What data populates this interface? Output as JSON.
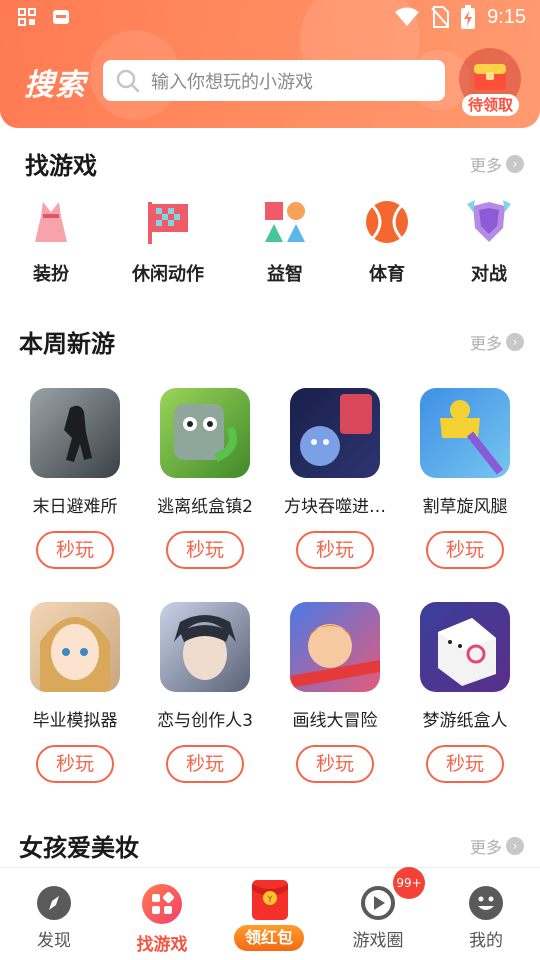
{
  "status_bar": {
    "time": "9:15"
  },
  "header": {
    "title": "搜索",
    "search_placeholder": "输入你想玩的小游戏",
    "gift_badge": "待领取"
  },
  "find_games": {
    "title": "找游戏",
    "more": "更多",
    "categories": [
      {
        "label": "装扮",
        "icon": "dress-icon"
      },
      {
        "label": "休闲动作",
        "icon": "checkered-flag-icon"
      },
      {
        "label": "益智",
        "icon": "shapes-icon"
      },
      {
        "label": "体育",
        "icon": "tennis-ball-icon"
      },
      {
        "label": "对战",
        "icon": "versus-shield-icon"
      }
    ]
  },
  "new_this_week": {
    "title": "本周新游",
    "more": "更多",
    "play_label": "秒玩",
    "games": [
      {
        "name": "末日避难所"
      },
      {
        "name": "逃离纸盒镇2"
      },
      {
        "name": "方块吞噬进…"
      },
      {
        "name": "割草旋风腿"
      },
      {
        "name": "毕业模拟器"
      },
      {
        "name": "恋与创作人3"
      },
      {
        "name": "画线大冒险"
      },
      {
        "name": "梦游纸盒人"
      }
    ]
  },
  "girls_makeup": {
    "title": "女孩爱美妆",
    "more": "更多"
  },
  "tabbar": {
    "tabs": [
      {
        "label": "发现",
        "icon": "compass-icon"
      },
      {
        "label": "找游戏",
        "icon": "grid-icon",
        "active": true
      },
      {
        "label": "领红包",
        "icon": "red-envelope-icon"
      },
      {
        "label": "游戏圈",
        "icon": "play-circle-icon"
      },
      {
        "label": "我的",
        "icon": "smiley-icon"
      }
    ],
    "circle_badge": "99+"
  },
  "colors": {
    "accent": "#f4553c",
    "header": "#ff8058"
  }
}
